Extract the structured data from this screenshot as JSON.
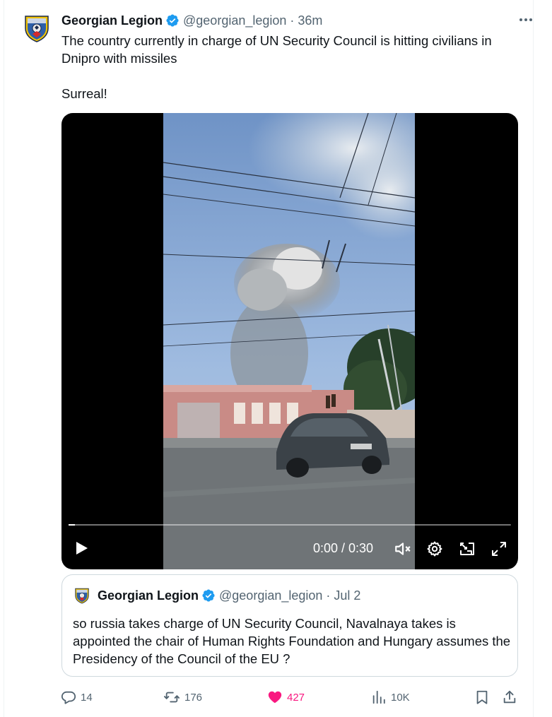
{
  "tweet": {
    "author": {
      "name": "Georgian Legion",
      "handle": "@georgian_legion",
      "time": "36m",
      "separator": "·"
    },
    "text_lines": [
      "The country currently in charge of UN Security Council is hitting civilians in Dnipro with missiles",
      "Surreal!"
    ]
  },
  "video": {
    "time_display": "0:00 / 0:30",
    "progress": 0.0,
    "controls": [
      "play-icon",
      "volume-icon",
      "settings-icon",
      "pip-icon",
      "fullscreen-icon"
    ]
  },
  "quote": {
    "author": {
      "name": "Georgian Legion",
      "handle": "@georgian_legion",
      "separator": "·",
      "time": "Jul 2"
    },
    "text": "so russia takes charge of UN Security Council, Navalnaya takes is appointed the chair of Human Rights Foundation and Hungary assumes the Presidency of the Council of the EU ?"
  },
  "actions": {
    "replies": "14",
    "reposts": "176",
    "likes": "427",
    "views": "10K"
  },
  "colors": {
    "verified": "#1d9bf0",
    "like": "#f91880",
    "muted": "#536471",
    "text": "#0f1419"
  }
}
